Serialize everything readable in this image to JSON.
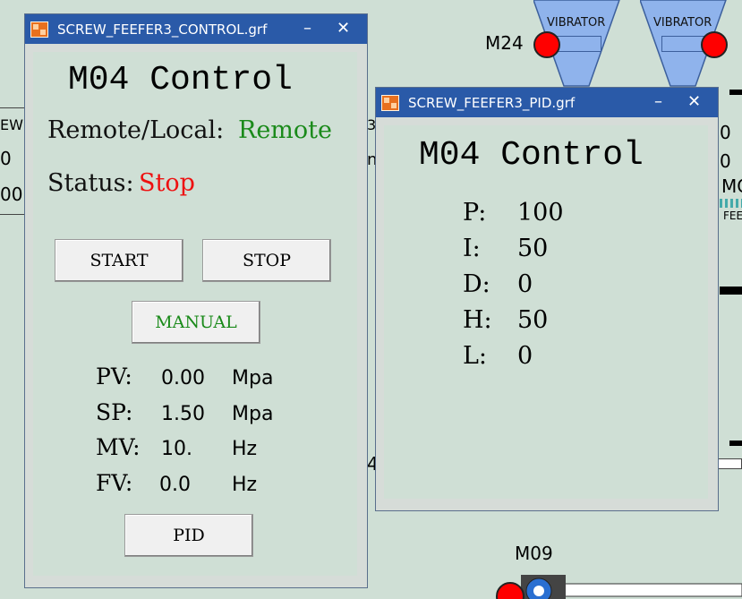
{
  "background": {
    "vibrator_label": "VIBRATOR",
    "motor_tags": [
      "M24",
      "M09"
    ],
    "left_edge_text": [
      "EW",
      "0",
      "00"
    ],
    "right_edge_text": [
      "0",
      "0",
      "MC",
      "FEE"
    ],
    "mid_fragments": [
      "3",
      "n",
      "4"
    ]
  },
  "control_window": {
    "title": "SCREW_FEEFER3_CONTROL.grf",
    "heading": "M04 Control",
    "remote_local_label": "Remote/Local:",
    "remote_local_value": "Remote",
    "status_label": "Status:",
    "status_value": "Stop",
    "start_button": "START",
    "stop_button": "STOP",
    "manual_button": "MANUAL",
    "pid_button": "PID",
    "readings": [
      {
        "label": "PV:",
        "value": "0.00",
        "unit": "Mpa"
      },
      {
        "label": "SP:",
        "value": "1.50",
        "unit": "Mpa"
      },
      {
        "label": "MV:",
        "value": "10.",
        "unit": "Hz"
      },
      {
        "label": "FV:",
        "value": "0.0",
        "unit": "Hz"
      }
    ]
  },
  "pid_window": {
    "title": "SCREW_FEEFER3_PID.grf",
    "heading": "M04 Control",
    "params": [
      {
        "label": "P:",
        "value": "100"
      },
      {
        "label": "I:",
        "value": "50"
      },
      {
        "label": "D:",
        "value": "0"
      },
      {
        "label": "H:",
        "value": "50"
      },
      {
        "label": "L:",
        "value": "0"
      }
    ]
  },
  "titlebar_buttons": {
    "minimize": "–",
    "close": "✕"
  },
  "colors": {
    "background": "#cfdfd5",
    "titlebar": "#2a5aa8",
    "remote_value": "#1a8a1a",
    "status_stop": "#ee1111",
    "manual_text": "#1a8a1a",
    "motor_dot": "#ff0000"
  }
}
